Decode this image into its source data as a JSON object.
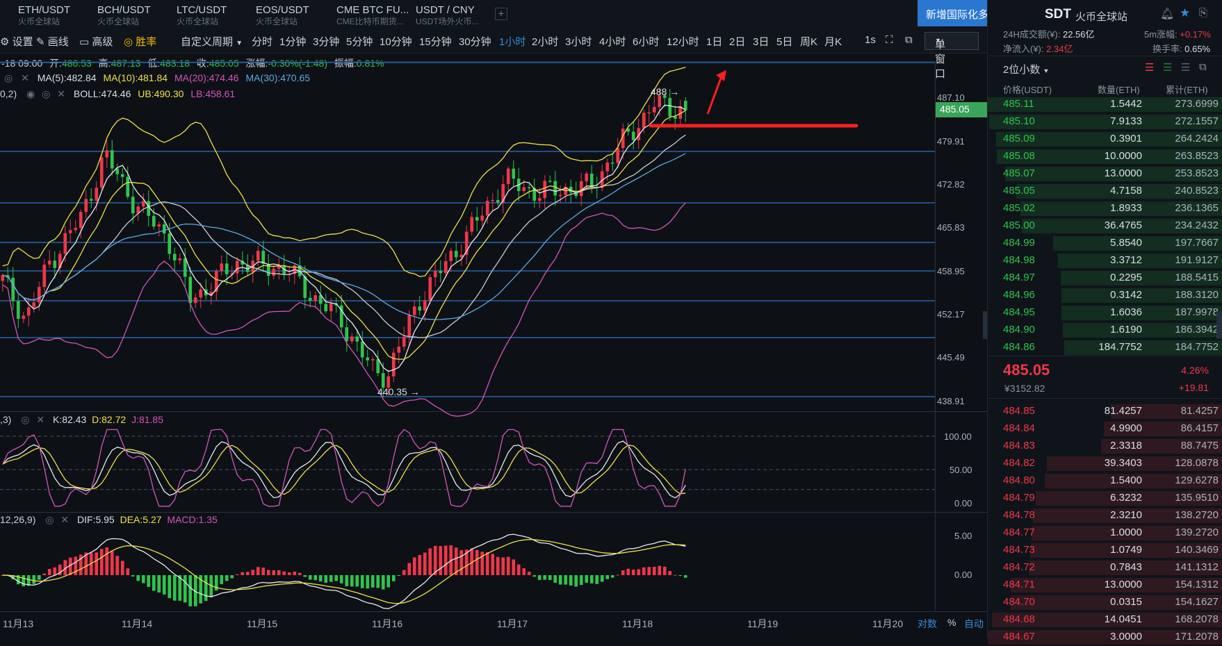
{
  "colors": {
    "up": "#f0364a",
    "down": "#30c44d",
    "accent": "#3a8bd8",
    "gold": "#f0b90b"
  },
  "tabs": [
    {
      "pair": "ETH/USDT",
      "site": "火币全球站"
    },
    {
      "pair": "BCH/USDT",
      "site": "火币全球站"
    },
    {
      "pair": "LTC/USDT",
      "site": "火币全球站"
    },
    {
      "pair": "EOS/USDT",
      "site": "火币全球站"
    },
    {
      "pair": "CME BTC FU...",
      "site": "CME比特币期货..."
    },
    {
      "pair": "USDT / CNY",
      "site": "USDT场外火币..."
    }
  ],
  "tab_add": "+",
  "notice": {
    "text": "新增国际化多语言",
    "close": "✕"
  },
  "toolbar": {
    "settings": "设置",
    "draw": "画线",
    "advanced": "高级",
    "winrate": "胜率",
    "custom": "自定义周期",
    "periods": [
      "分时",
      "1分钟",
      "3分钟",
      "5分钟",
      "10分钟",
      "15分钟",
      "30分钟",
      "1小时",
      "2小时",
      "3小时",
      "4小时",
      "6小时",
      "12小时",
      "1日",
      "2日",
      "3日",
      "5日",
      "周K",
      "月K"
    ],
    "active_period": "1小时",
    "seconds": "1s",
    "window": "单窗口"
  },
  "ohlc": {
    "date": "-18 09:00",
    "open_label": "开:",
    "open": "486.53",
    "high_label": "高:",
    "high": "487.13",
    "low_label": "低:",
    "low": "483.18",
    "close_label": "收:",
    "close": "485.05",
    "chg_label": "涨幅:",
    "chg": "-0.30%(-1.48)",
    "amp_label": "振幅:",
    "amp": "0.81%"
  },
  "ma": {
    "ma5": "MA(5):482.84",
    "ma10": "MA(10):481.84",
    "ma20": "MA(20):474.46",
    "ma30": "MA(30):470.65"
  },
  "boll": {
    "prefix": "0,2)",
    "boll": "BOLL:474.46",
    "ub": "UB:490.30",
    "lb": "LB:458.61"
  },
  "kdj": {
    "prefix": ",3)",
    "k": "K:82.43",
    "d": "D:82.72",
    "j": "J:81.85"
  },
  "macd": {
    "prefix": "12,26,9)",
    "dif": "DIF:5.95",
    "dea": "DEA:5.27",
    "macd": "MACD:1.35"
  },
  "y_main": [
    "487.10",
    "479.91",
    "472.82",
    "465.83",
    "458.95",
    "452.17",
    "445.49",
    "438.91"
  ],
  "y_kdj": [
    "100.00",
    "50.00",
    "0.00"
  ],
  "y_macd": [
    "5.00",
    "0.00"
  ],
  "price_badge": "485.05",
  "annotations": {
    "high": "488",
    "low": "440.35"
  },
  "x_labels": [
    "11月13",
    "11月14",
    "11月15",
    "11月16",
    "11月17",
    "11月18",
    "11月19",
    "11月20"
  ],
  "x_options": [
    "对数",
    "%",
    "自动"
  ],
  "right": {
    "title": "SDT",
    "site": "火币全球站",
    "vol_label": "24H成交额(¥):",
    "vol": "22.56亿",
    "inflow_label": "净流入(¥):",
    "inflow": "2.34亿",
    "chg5_label": "5m涨幅:",
    "chg5": "+0.17%",
    "turnover_label": "换手率:",
    "turnover": "0.65%",
    "decimals": "2位小数",
    "headers": {
      "price": "价格(USDT)",
      "qty": "数量(ETH)",
      "cum": "累计(ETH)"
    },
    "bids": [
      [
        "485.11",
        "1.5442",
        "273.6999"
      ],
      [
        "485.10",
        "7.9133",
        "272.1557"
      ],
      [
        "485.09",
        "0.3901",
        "264.2424"
      ],
      [
        "485.08",
        "10.0000",
        "263.8523"
      ],
      [
        "485.07",
        "13.0000",
        "253.8523"
      ],
      [
        "485.05",
        "4.7158",
        "240.8523"
      ],
      [
        "485.02",
        "1.8933",
        "236.1365"
      ],
      [
        "485.00",
        "36.4765",
        "234.2432"
      ],
      [
        "484.99",
        "5.8540",
        "197.7667"
      ],
      [
        "484.98",
        "3.3712",
        "191.9127"
      ],
      [
        "484.97",
        "0.2295",
        "188.5415"
      ],
      [
        "484.96",
        "0.3142",
        "188.3120"
      ],
      [
        "484.95",
        "1.6036",
        "187.9978"
      ],
      [
        "484.90",
        "1.6190",
        "186.3942"
      ],
      [
        "484.86",
        "184.7752",
        "184.7752"
      ]
    ],
    "last_price": "485.05",
    "last_cny": "¥3152.82",
    "last_pct": "4.26%",
    "last_chg": "+19.81",
    "asks": [
      [
        "484.85",
        "81.4257",
        "81.4257"
      ],
      [
        "484.84",
        "4.9900",
        "86.4157"
      ],
      [
        "484.83",
        "2.3318",
        "88.7475"
      ],
      [
        "484.82",
        "39.3403",
        "128.0878"
      ],
      [
        "484.80",
        "1.5400",
        "129.6278"
      ],
      [
        "484.79",
        "6.3232",
        "135.9510"
      ],
      [
        "484.78",
        "2.3210",
        "138.2720"
      ],
      [
        "484.77",
        "1.0000",
        "139.2720"
      ],
      [
        "484.73",
        "1.0749",
        "140.3469"
      ],
      [
        "484.72",
        "0.7843",
        "141.1312"
      ],
      [
        "484.71",
        "13.0000",
        "154.1312"
      ],
      [
        "484.70",
        "0.0315",
        "154.1627"
      ],
      [
        "484.68",
        "14.0451",
        "168.2078"
      ],
      [
        "484.67",
        "3.0000",
        "171.2078"
      ]
    ]
  }
}
